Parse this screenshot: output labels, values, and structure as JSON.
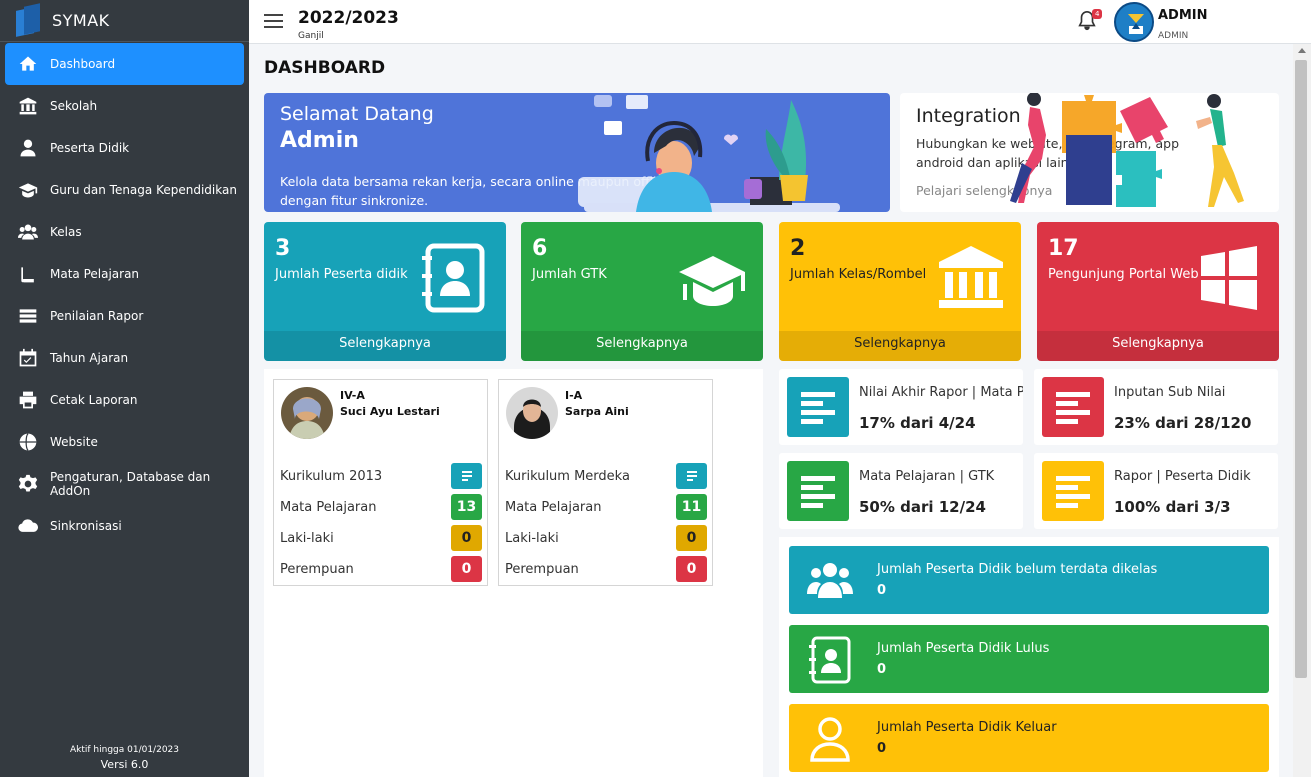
{
  "sidebar": {
    "brand": "SYMAK",
    "items": [
      {
        "label": "Dashboard",
        "icon": "home-icon",
        "active": true
      },
      {
        "label": "Sekolah",
        "icon": "school-building-icon"
      },
      {
        "label": "Peserta Didik",
        "icon": "user-icon"
      },
      {
        "label": "Guru dan Tenaga Kependidikan",
        "icon": "graduation-cap-icon"
      },
      {
        "label": "Kelas",
        "icon": "users-icon"
      },
      {
        "label": "Mata Pelajaran",
        "icon": "book-icon"
      },
      {
        "label": "Penilaian Rapor",
        "icon": "list-icon"
      },
      {
        "label": "Tahun Ajaran",
        "icon": "calendar-check-icon"
      },
      {
        "label": "Cetak Laporan",
        "icon": "print-icon"
      },
      {
        "label": "Website",
        "icon": "globe-icon"
      },
      {
        "label": "Pengaturan, Database dan AddOn",
        "icon": "gear-icon"
      },
      {
        "label": "Sinkronisasi",
        "icon": "cloud-icon"
      }
    ],
    "footer": {
      "active_until": "Aktif hingga 01/01/2023",
      "version": "Versi 6.0"
    }
  },
  "header": {
    "school_year": "2022/2023",
    "semester": "Ganjil",
    "notification_count": "4",
    "user_name": "ADMIN",
    "user_role": "ADMIN"
  },
  "page": {
    "title": "DASHBOARD"
  },
  "welcome": {
    "greeting": "Selamat Datang",
    "name": "Admin",
    "description": "Kelola data bersama rekan kerja, secara online maupun offline dengan fitur sinkronize."
  },
  "integration": {
    "title": "Integration",
    "description": "Hubungkan ke website, bot telegram, app android dan aplikasi lainnya",
    "link": "Pelajari selengkapnya"
  },
  "stats": [
    {
      "value": "3",
      "label": "Jumlah Peserta didik",
      "more": "Selengkapnya",
      "color": "#17a2b8",
      "icon": "contact-book-icon"
    },
    {
      "value": "6",
      "label": "Jumlah GTK",
      "more": "Selengkapnya",
      "color": "#28a745",
      "icon": "graduation-cap-icon"
    },
    {
      "value": "2",
      "label": "Jumlah Kelas/Rombel",
      "more": "Selengkapnya",
      "color": "#ffc107",
      "icon": "institution-icon"
    },
    {
      "value": "17",
      "label": "Pengunjung Portal Web",
      "more": "Selengkapnya",
      "color": "#dc3545",
      "icon": "windows-icon"
    }
  ],
  "classes": [
    {
      "class_name": "IV-A",
      "teacher": "Suci Ayu Lestari",
      "rows": [
        {
          "label": "Kurikulum 2013",
          "value": "",
          "icon": "list-alt-icon"
        },
        {
          "label": "Mata Pelajaran",
          "value": "13"
        },
        {
          "label": "Laki-laki",
          "value": "0"
        },
        {
          "label": "Perempuan",
          "value": "0"
        }
      ]
    },
    {
      "class_name": "I-A",
      "teacher": "Sarpa Aini",
      "rows": [
        {
          "label": "Kurikulum Merdeka",
          "value": "",
          "icon": "list-alt-icon"
        },
        {
          "label": "Mata Pelajaran",
          "value": "11"
        },
        {
          "label": "Laki-laki",
          "value": "0"
        },
        {
          "label": "Perempuan",
          "value": "0"
        }
      ]
    }
  ],
  "progress": [
    {
      "title": "Nilai Akhir Rapor | Mata Pelajaran",
      "value": "17% dari 4/24",
      "color": "#17a2b8"
    },
    {
      "title": "Inputan Sub Nilai",
      "value": "23% dari 28/120",
      "color": "#dc3545"
    },
    {
      "title": "Mata Pelajaran | GTK",
      "value": "50% dari 12/24",
      "color": "#28a745"
    },
    {
      "title": "Rapor | Peserta Didik",
      "value": "100% dari 3/3",
      "color": "#ffc107"
    }
  ],
  "summary": [
    {
      "title": "Jumlah Peserta Didik belum terdata dikelas",
      "value": "0",
      "color": "#17a2b8",
      "icon": "users-icon"
    },
    {
      "title": "Jumlah Peserta Didik Lulus",
      "value": "0",
      "color": "#28a745",
      "icon": "contact-book-icon"
    },
    {
      "title": "Jumlah Peserta Didik Keluar",
      "value": "0",
      "color": "#ffc107",
      "icon": "user-outline-icon"
    }
  ]
}
